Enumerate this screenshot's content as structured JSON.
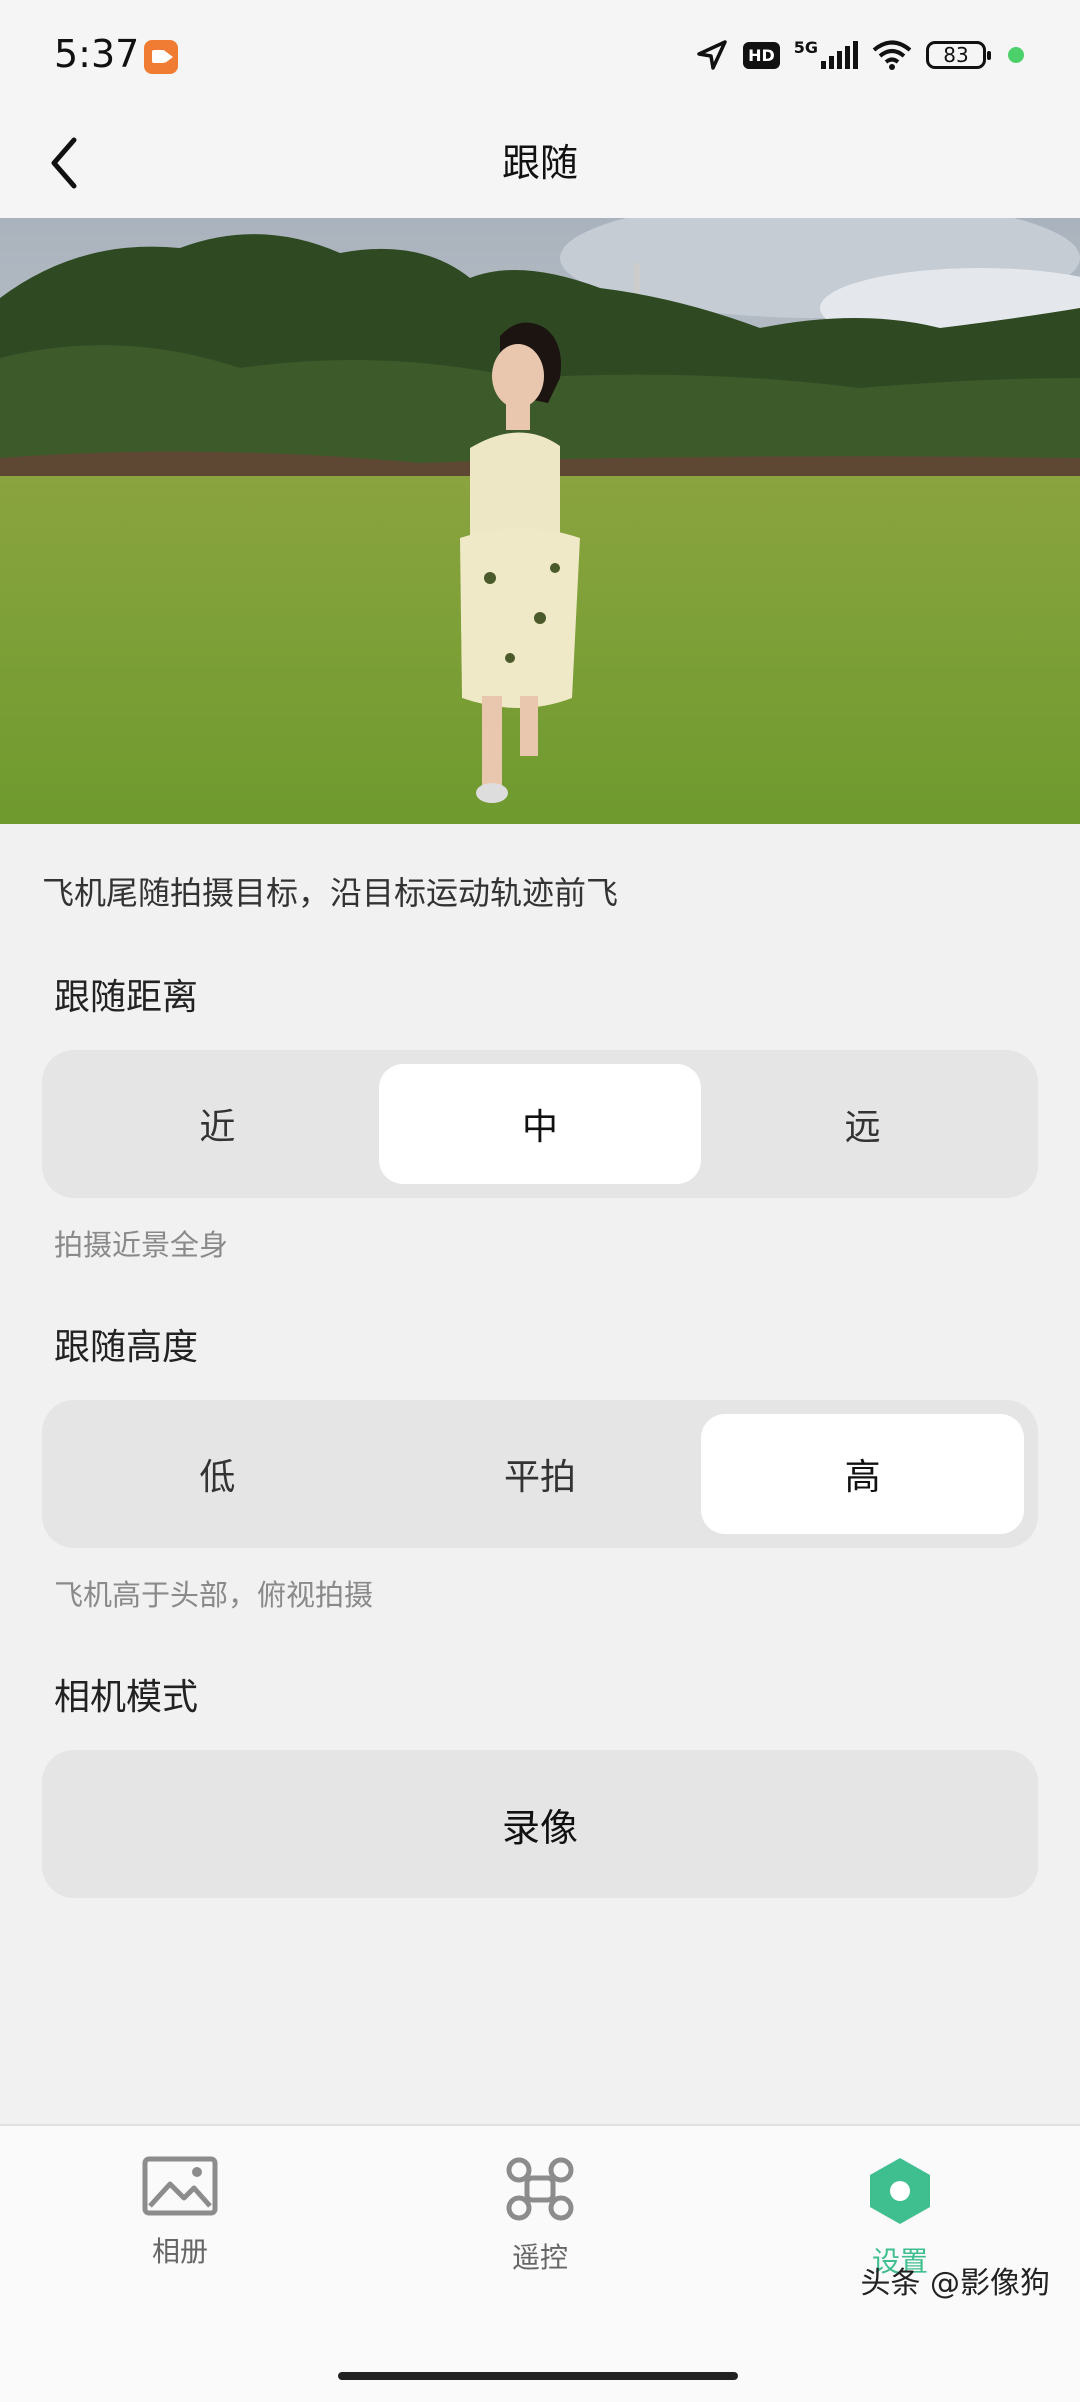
{
  "status": {
    "time": "5:37",
    "hd": "HD",
    "network": "5G",
    "battery": "83"
  },
  "header": {
    "title": "跟随"
  },
  "description": "飞机尾随拍摄目标，沿目标运动轨迹前飞",
  "distance": {
    "label": "跟随距离",
    "options": [
      "近",
      "中",
      "远"
    ],
    "selected": "中",
    "hint": "拍摄近景全身"
  },
  "height": {
    "label": "跟随高度",
    "options": [
      "低",
      "平拍",
      "高"
    ],
    "selected": "高",
    "hint": "飞机高于头部，俯视拍摄"
  },
  "camera": {
    "label": "相机模式",
    "value": "录像"
  },
  "tabs": [
    {
      "label": "相册",
      "icon": "album-icon"
    },
    {
      "label": "遥控",
      "icon": "drone-icon"
    },
    {
      "label": "设置",
      "icon": "settings-icon"
    }
  ],
  "active_tab": "设置",
  "watermark": "头条 @影像狗",
  "colors": {
    "accent": "#3fbf8f",
    "recording": "#f07c34"
  }
}
